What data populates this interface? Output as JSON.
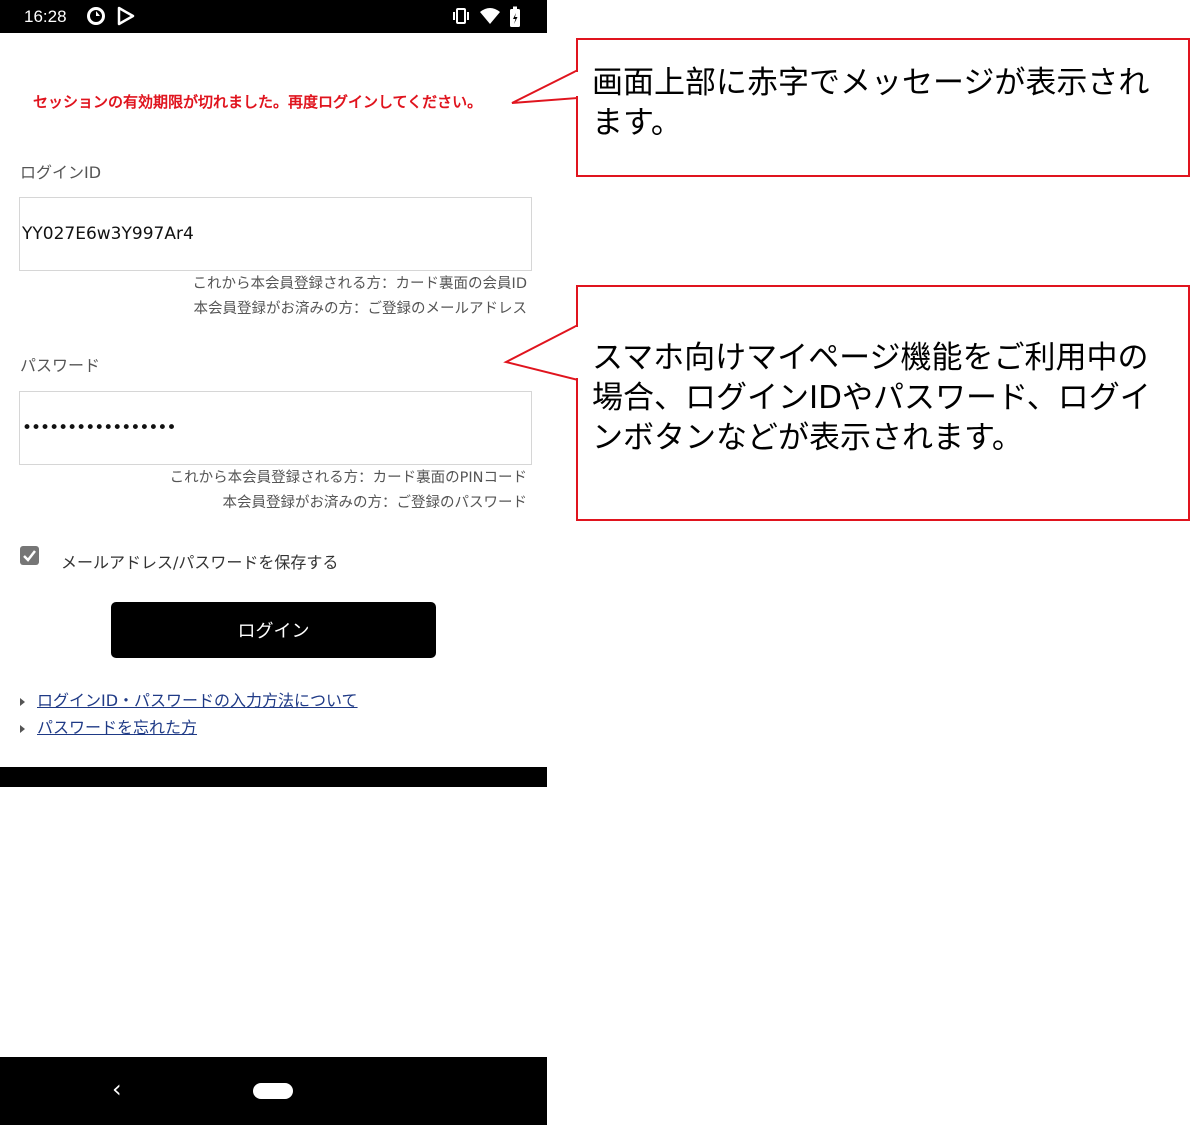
{
  "status_bar": {
    "time": "16:28",
    "left_icons": [
      "sync-icon",
      "play-store-icon"
    ],
    "right_icons": [
      "vibrate-icon",
      "wifi-icon",
      "battery-icon"
    ]
  },
  "error_message": "セッションの有効期限が切れました。再度ログインしてください。",
  "login_id": {
    "label": "ログインID",
    "value": "YY027E6w3Y997Ar4",
    "hint_line1": "これから本会員登録される方：カード裏面の会員ID",
    "hint_line2": "本会員登録がお済みの方：ご登録のメールアドレス"
  },
  "password": {
    "label": "パスワード",
    "value": "•••••••••••••••••",
    "hint_line1": "これから本会員登録される方：カード裏面のPINコード",
    "hint_line2": "本会員登録がお済みの方：ご登録のパスワード"
  },
  "remember": {
    "label": "メールアドレス/パスワードを保存する",
    "checked": true
  },
  "login_button": "ログイン",
  "links": {
    "input_help": "ログインID・パスワードの入力方法について",
    "forgot_password": "パスワードを忘れた方"
  },
  "nav_bar": {
    "back_icon": "‹"
  },
  "callouts": {
    "top": "画面上部に赤字でメッセージが表示されます。",
    "middle": "スマホ向けマイページ機能をご利用中の場合、ログインIDやパスワード、ログインボタンなどが表示されます。"
  },
  "colors": {
    "error_red": "#e0141e",
    "link_blue": "#1f3a86",
    "button_black": "#000000"
  }
}
